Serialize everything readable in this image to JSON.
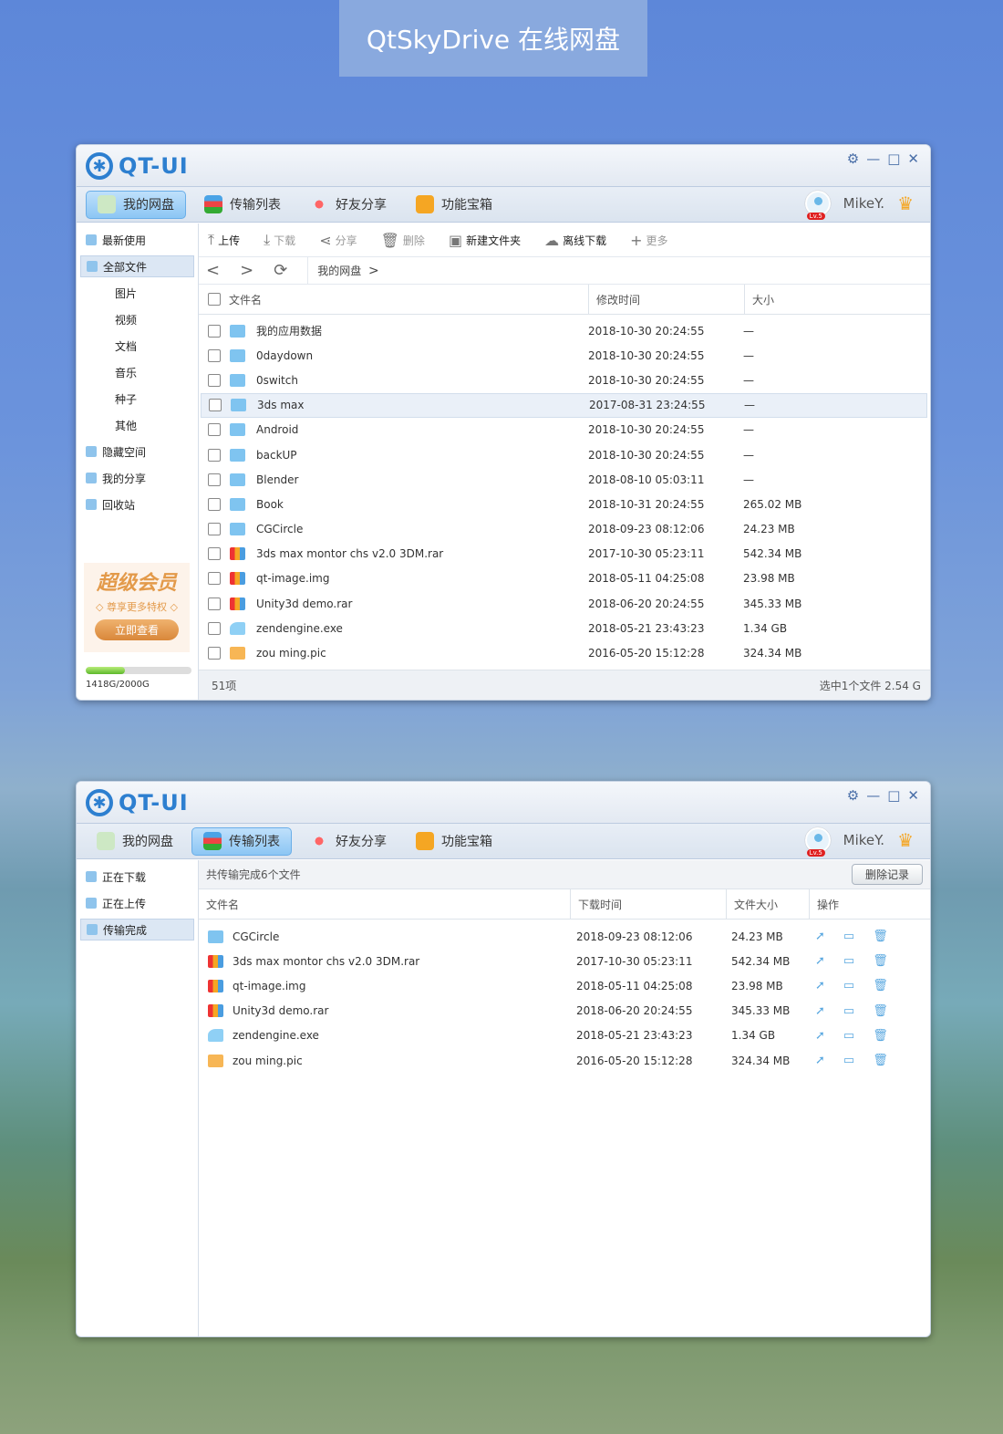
{
  "banner": "QtSkyDrive 在线网盘",
  "app": {
    "logo": "QT-UI",
    "user": "MikeY.",
    "level": "Lv.5",
    "nav": [
      "我的网盘",
      "传输列表",
      "好友分享",
      "功能宝箱"
    ]
  },
  "win1": {
    "sidebar": [
      {
        "label": "最新使用",
        "sub": false
      },
      {
        "label": "全部文件",
        "sub": false,
        "active": true
      },
      {
        "label": "图片",
        "sub": true
      },
      {
        "label": "视频",
        "sub": true
      },
      {
        "label": "文档",
        "sub": true
      },
      {
        "label": "音乐",
        "sub": true
      },
      {
        "label": "种子",
        "sub": true
      },
      {
        "label": "其他",
        "sub": true
      },
      {
        "label": "隐藏空间",
        "sub": false
      },
      {
        "label": "我的分享",
        "sub": false
      },
      {
        "label": "回收站",
        "sub": false
      }
    ],
    "promo": {
      "title": "超级会员",
      "subtitle": "◇ 尊享更多特权 ◇",
      "button": "立即查看"
    },
    "quota": {
      "text": "1418G/2000G",
      "fraction": 0.37
    },
    "toolbar": [
      {
        "label": "上传",
        "icon": "upload-icon",
        "enabled": true
      },
      {
        "label": "下载",
        "icon": "download-icon",
        "enabled": false
      },
      {
        "label": "分享",
        "icon": "share-icon",
        "enabled": false
      },
      {
        "label": "删除",
        "icon": "trash-icon",
        "enabled": false
      },
      {
        "label": "新建文件夹",
        "icon": "new-folder-icon",
        "enabled": true
      },
      {
        "label": "离线下载",
        "icon": "cloud-download-icon",
        "enabled": true
      },
      {
        "label": "更多",
        "icon": "plus-icon",
        "enabled": false
      }
    ],
    "breadcrumb": "我的网盘",
    "columns": [
      "文件名",
      "修改时间",
      "大小"
    ],
    "files": [
      {
        "name": "我的应用数据",
        "type": "folder",
        "time": "2018-10-30 20:24:55",
        "size": "—"
      },
      {
        "name": "0daydown",
        "type": "folder",
        "time": "2018-10-30 20:24:55",
        "size": "—"
      },
      {
        "name": "0switch",
        "type": "folder",
        "time": "2018-10-30 20:24:55",
        "size": "—"
      },
      {
        "name": "3ds max",
        "type": "folder",
        "time": "2017-08-31 23:24:55",
        "size": "—",
        "selected": true
      },
      {
        "name": "Android",
        "type": "folder",
        "time": "2018-10-30 20:24:55",
        "size": "—"
      },
      {
        "name": "backUP",
        "type": "folder",
        "time": "2018-10-30 20:24:55",
        "size": "—"
      },
      {
        "name": "Blender",
        "type": "folder",
        "time": "2018-08-10 05:03:11",
        "size": "—"
      },
      {
        "name": "Book",
        "type": "folder",
        "time": "2018-10-31 20:24:55",
        "size": "265.02 MB"
      },
      {
        "name": "CGCircle",
        "type": "folder",
        "time": "2018-09-23 08:12:06",
        "size": "24.23 MB"
      },
      {
        "name": "3ds max montor chs v2.0 3DM.rar",
        "type": "rar",
        "time": "2017-10-30 05:23:11",
        "size": "542.34 MB"
      },
      {
        "name": "qt-image.img",
        "type": "rar",
        "time": "2018-05-11 04:25:08",
        "size": "23.98 MB"
      },
      {
        "name": "Unity3d demo.rar",
        "type": "rar",
        "time": "2018-06-20 20:24:55",
        "size": "345.33 MB"
      },
      {
        "name": "zendengine.exe",
        "type": "exe",
        "time": "2018-05-21 23:43:23",
        "size": "1.34 GB"
      },
      {
        "name": "zou ming.pic",
        "type": "pic",
        "time": "2016-05-20 15:12:28",
        "size": "324.34 MB"
      }
    ],
    "status_left": "51项",
    "status_right": "选中1个文件 2.54 G"
  },
  "win2": {
    "sidebar": [
      {
        "label": "正在下载"
      },
      {
        "label": "正在上传"
      },
      {
        "label": "传输完成",
        "active": true
      }
    ],
    "summary": "共传输完成6个文件",
    "delete_button": "删除记录",
    "columns": [
      "文件名",
      "下载时间",
      "文件大小",
      "操作"
    ],
    "files": [
      {
        "name": "CGCircle",
        "type": "folder",
        "time": "2018-09-23 08:12:06",
        "size": "24.23 MB"
      },
      {
        "name": "3ds max montor chs v2.0 3DM.rar",
        "type": "rar",
        "time": "2017-10-30 05:23:11",
        "size": "542.34 MB"
      },
      {
        "name": "qt-image.img",
        "type": "rar",
        "time": "2018-05-11 04:25:08",
        "size": "23.98 MB"
      },
      {
        "name": "Unity3d demo.rar",
        "type": "rar",
        "time": "2018-06-20 20:24:55",
        "size": "345.33 MB"
      },
      {
        "name": "zendengine.exe",
        "type": "exe",
        "time": "2018-05-21 23:43:23",
        "size": "1.34 GB"
      },
      {
        "name": "zou ming.pic",
        "type": "pic",
        "time": "2016-05-20 15:12:28",
        "size": "324.34 MB"
      }
    ]
  }
}
